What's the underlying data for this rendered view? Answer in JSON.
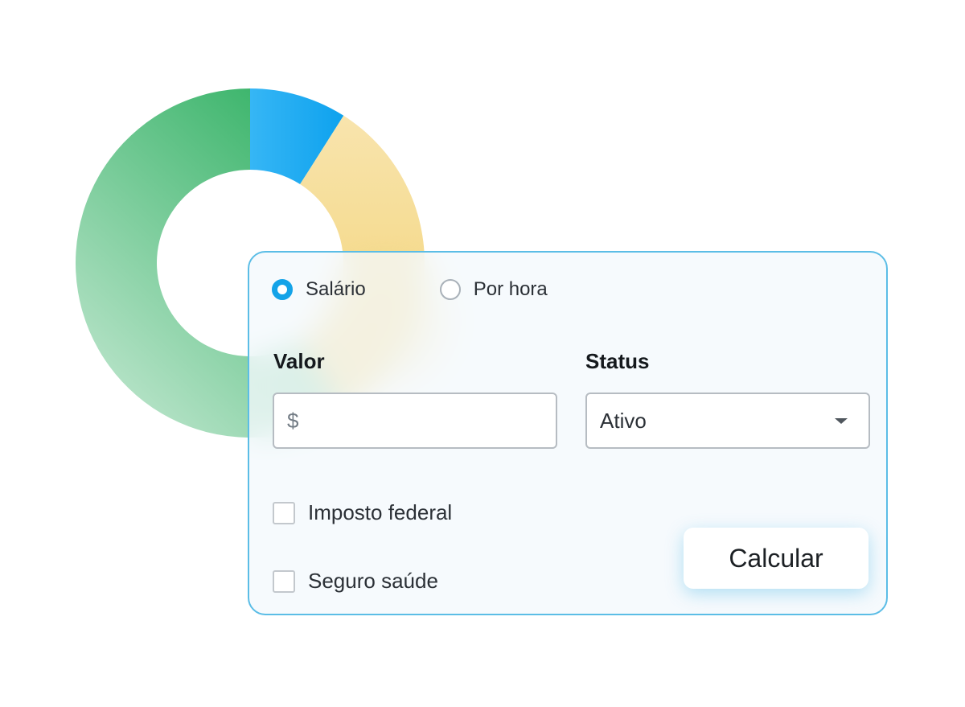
{
  "chart_data": {
    "type": "pie",
    "style": "donut",
    "slices": [
      {
        "value": 9,
        "color": "#16a6f0"
      },
      {
        "value": 32,
        "color": "#f3d67a"
      },
      {
        "value": 59,
        "color": "#3bb36b"
      }
    ]
  },
  "form": {
    "radio_options": [
      {
        "label": "Salário",
        "checked": true
      },
      {
        "label": "Por hora",
        "checked": false
      }
    ],
    "valor": {
      "label": "Valor",
      "prefix": "$",
      "value": ""
    },
    "status": {
      "label": "Status",
      "selected": "Ativo"
    },
    "checkboxes": [
      {
        "label": "Imposto federal",
        "checked": false
      },
      {
        "label": "Seguro saúde",
        "checked": false
      }
    ],
    "calculate_label": "Calcular"
  },
  "colors": {
    "accent": "#14a3e8",
    "card_border": "#5bbde6",
    "donut_blue": "#16a6f0",
    "donut_yellow": "#f3d67a",
    "donut_green": "#3bb36b"
  },
  "icons": {
    "select_caret": "chevron-down-icon"
  }
}
